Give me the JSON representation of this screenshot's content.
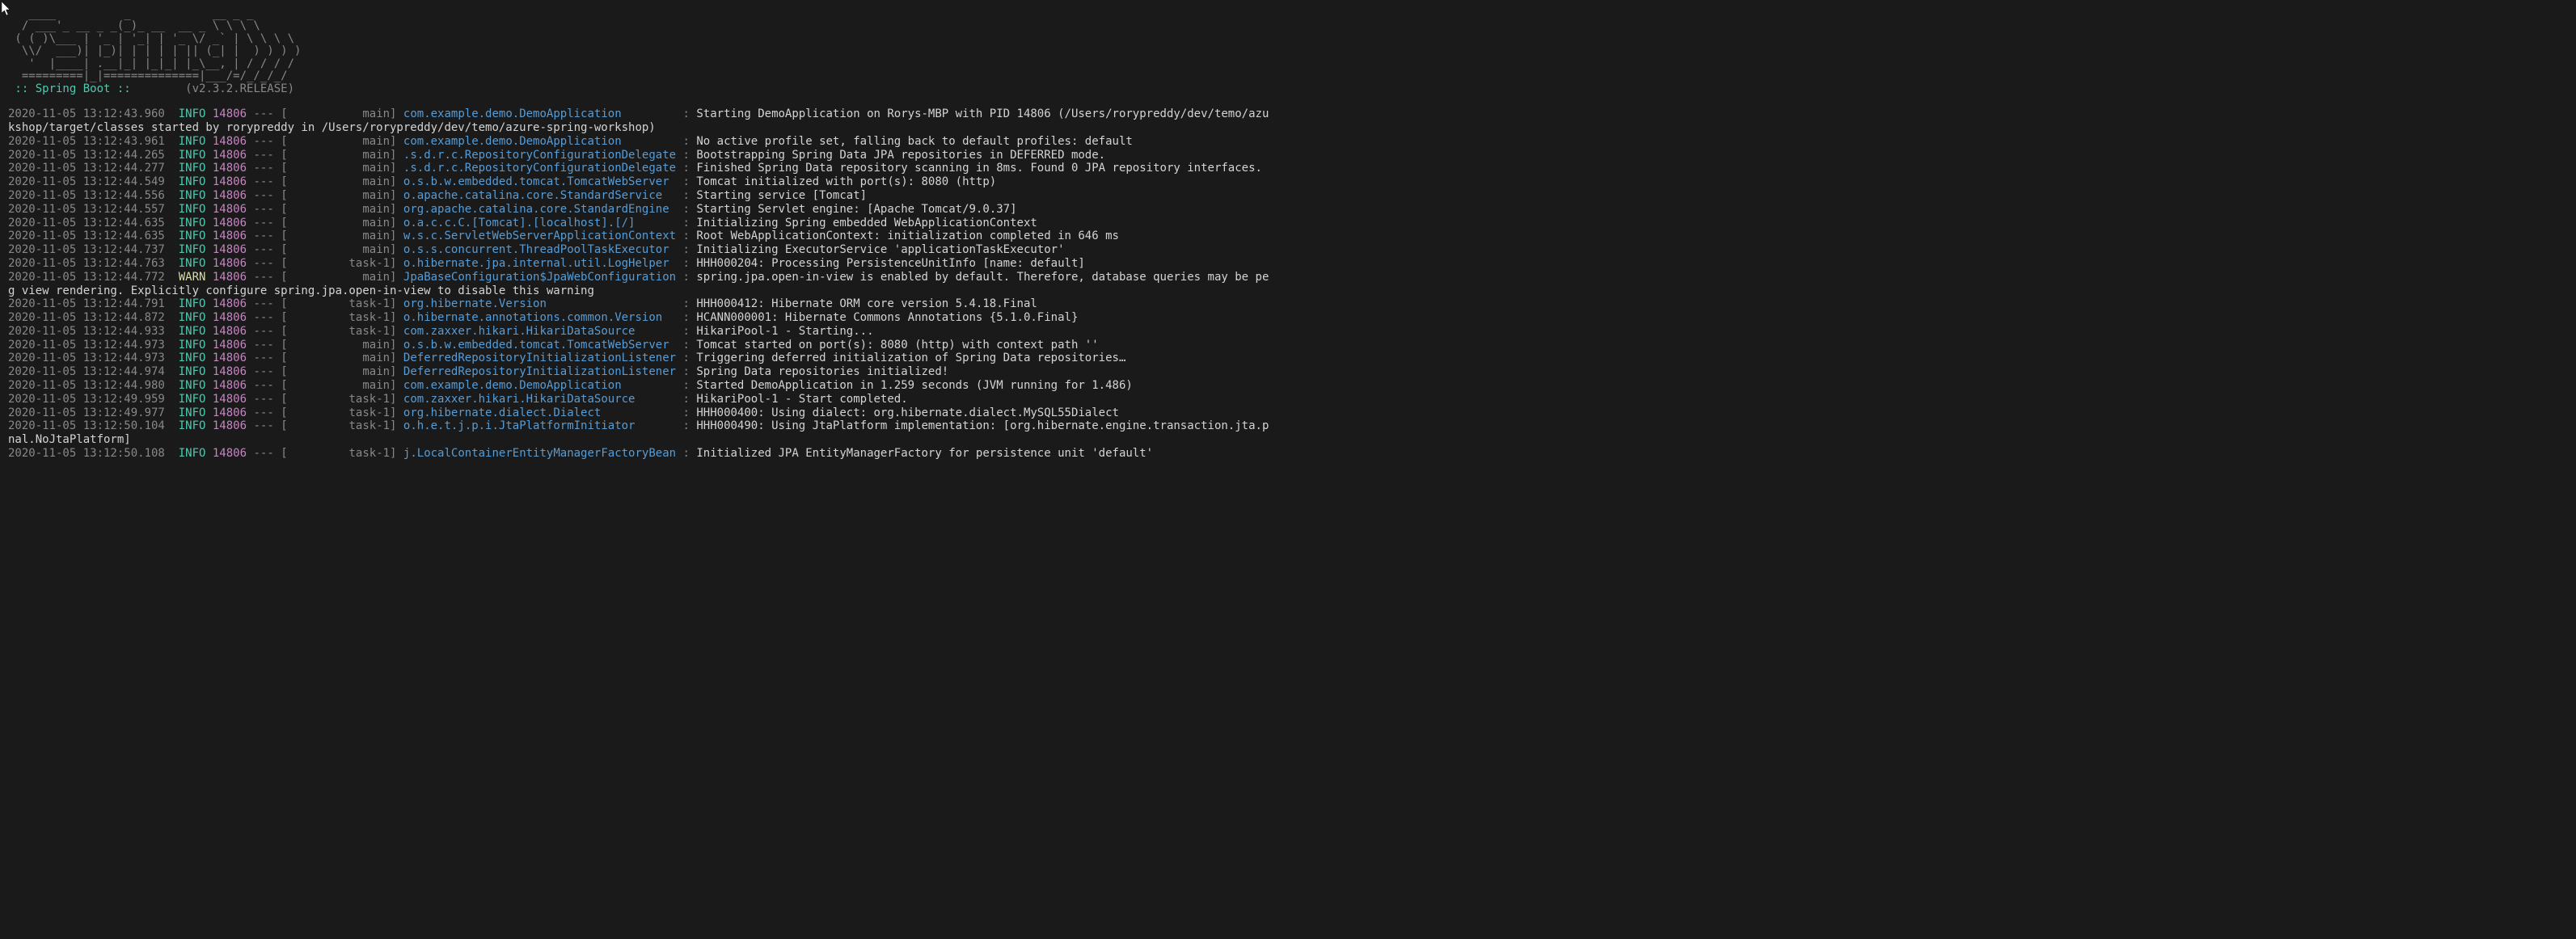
{
  "ascii_art": "   ____          _            __ _ _\n  / ___'_ __ _ _(_)_ __  __ _ \\ \\ \\ \\\n ( ( )\\___ | '_ | '_| | '_ \\/ _` | \\ \\ \\ \\\n  \\\\/  ___)| |_)| | | | | || (_| |  ) ) ) )\n   '  |____| .__|_| |_|_| |_\\__, | / / / /\n  =========|_|==============|___/=/_/_/_/",
  "banner": {
    "label": " :: Spring Boot ::",
    "spacer": "        ",
    "version": "(v2.3.2.RELEASE)"
  },
  "logs": [
    {
      "ts": "2020-11-05 13:12:43.960",
      "level": "INFO",
      "pid": "14806",
      "thread": "main",
      "logger": "com.example.demo.DemoApplication",
      "msg": "Starting DemoApplication on Rorys-MBP with PID 14806 (/Users/rorypreddy/dev/temo/azu"
    },
    {
      "wrap": "kshop/target/classes started by rorypreddy in /Users/rorypreddy/dev/temo/azure-spring-workshop)"
    },
    {
      "ts": "2020-11-05 13:12:43.961",
      "level": "INFO",
      "pid": "14806",
      "thread": "main",
      "logger": "com.example.demo.DemoApplication",
      "msg": "No active profile set, falling back to default profiles: default"
    },
    {
      "ts": "2020-11-05 13:12:44.265",
      "level": "INFO",
      "pid": "14806",
      "thread": "main",
      "logger": ".s.d.r.c.RepositoryConfigurationDelegate",
      "msg": "Bootstrapping Spring Data JPA repositories in DEFERRED mode."
    },
    {
      "ts": "2020-11-05 13:12:44.277",
      "level": "INFO",
      "pid": "14806",
      "thread": "main",
      "logger": ".s.d.r.c.RepositoryConfigurationDelegate",
      "msg": "Finished Spring Data repository scanning in 8ms. Found 0 JPA repository interfaces."
    },
    {
      "ts": "2020-11-05 13:12:44.549",
      "level": "INFO",
      "pid": "14806",
      "thread": "main",
      "logger": "o.s.b.w.embedded.tomcat.TomcatWebServer",
      "msg": "Tomcat initialized with port(s): 8080 (http)"
    },
    {
      "ts": "2020-11-05 13:12:44.556",
      "level": "INFO",
      "pid": "14806",
      "thread": "main",
      "logger": "o.apache.catalina.core.StandardService",
      "msg": "Starting service [Tomcat]"
    },
    {
      "ts": "2020-11-05 13:12:44.557",
      "level": "INFO",
      "pid": "14806",
      "thread": "main",
      "logger": "org.apache.catalina.core.StandardEngine",
      "msg": "Starting Servlet engine: [Apache Tomcat/9.0.37]"
    },
    {
      "ts": "2020-11-05 13:12:44.635",
      "level": "INFO",
      "pid": "14806",
      "thread": "main",
      "logger": "o.a.c.c.C.[Tomcat].[localhost].[/]",
      "msg": "Initializing Spring embedded WebApplicationContext"
    },
    {
      "ts": "2020-11-05 13:12:44.635",
      "level": "INFO",
      "pid": "14806",
      "thread": "main",
      "logger": "w.s.c.ServletWebServerApplicationContext",
      "msg": "Root WebApplicationContext: initialization completed in 646 ms"
    },
    {
      "ts": "2020-11-05 13:12:44.737",
      "level": "INFO",
      "pid": "14806",
      "thread": "main",
      "logger": "o.s.s.concurrent.ThreadPoolTaskExecutor",
      "msg": "Initializing ExecutorService 'applicationTaskExecutor'"
    },
    {
      "ts": "2020-11-05 13:12:44.763",
      "level": "INFO",
      "pid": "14806",
      "thread": "task-1",
      "logger": "o.hibernate.jpa.internal.util.LogHelper",
      "msg": "HHH000204: Processing PersistenceUnitInfo [name: default]"
    },
    {
      "ts": "2020-11-05 13:12:44.772",
      "level": "WARN",
      "pid": "14806",
      "thread": "main",
      "logger": "JpaBaseConfiguration$JpaWebConfiguration",
      "msg": "spring.jpa.open-in-view is enabled by default. Therefore, database queries may be pe"
    },
    {
      "wrap": "g view rendering. Explicitly configure spring.jpa.open-in-view to disable this warning"
    },
    {
      "ts": "2020-11-05 13:12:44.791",
      "level": "INFO",
      "pid": "14806",
      "thread": "task-1",
      "logger": "org.hibernate.Version",
      "msg": "HHH000412: Hibernate ORM core version 5.4.18.Final"
    },
    {
      "ts": "2020-11-05 13:12:44.872",
      "level": "INFO",
      "pid": "14806",
      "thread": "task-1",
      "logger": "o.hibernate.annotations.common.Version",
      "msg": "HCANN000001: Hibernate Commons Annotations {5.1.0.Final}"
    },
    {
      "ts": "2020-11-05 13:12:44.933",
      "level": "INFO",
      "pid": "14806",
      "thread": "task-1",
      "logger": "com.zaxxer.hikari.HikariDataSource",
      "msg": "HikariPool-1 - Starting..."
    },
    {
      "ts": "2020-11-05 13:12:44.973",
      "level": "INFO",
      "pid": "14806",
      "thread": "main",
      "logger": "o.s.b.w.embedded.tomcat.TomcatWebServer",
      "msg": "Tomcat started on port(s): 8080 (http) with context path ''"
    },
    {
      "ts": "2020-11-05 13:12:44.973",
      "level": "INFO",
      "pid": "14806",
      "thread": "main",
      "logger": "DeferredRepositoryInitializationListener",
      "msg": "Triggering deferred initialization of Spring Data repositories…"
    },
    {
      "ts": "2020-11-05 13:12:44.974",
      "level": "INFO",
      "pid": "14806",
      "thread": "main",
      "logger": "DeferredRepositoryInitializationListener",
      "msg": "Spring Data repositories initialized!"
    },
    {
      "ts": "2020-11-05 13:12:44.980",
      "level": "INFO",
      "pid": "14806",
      "thread": "main",
      "logger": "com.example.demo.DemoApplication",
      "msg": "Started DemoApplication in 1.259 seconds (JVM running for 1.486)"
    },
    {
      "ts": "2020-11-05 13:12:49.959",
      "level": "INFO",
      "pid": "14806",
      "thread": "task-1",
      "logger": "com.zaxxer.hikari.HikariDataSource",
      "msg": "HikariPool-1 - Start completed."
    },
    {
      "ts": "2020-11-05 13:12:49.977",
      "level": "INFO",
      "pid": "14806",
      "thread": "task-1",
      "logger": "org.hibernate.dialect.Dialect",
      "msg": "HHH000400: Using dialect: org.hibernate.dialect.MySQL55Dialect"
    },
    {
      "ts": "2020-11-05 13:12:50.104",
      "level": "INFO",
      "pid": "14806",
      "thread": "task-1",
      "logger": "o.h.e.t.j.p.i.JtaPlatformInitiator",
      "msg": "HHH000490: Using JtaPlatform implementation: [org.hibernate.engine.transaction.jta.p"
    },
    {
      "wrap": "nal.NoJtaPlatform]"
    },
    {
      "ts": "2020-11-05 13:12:50.108",
      "level": "INFO",
      "pid": "14806",
      "thread": "task-1",
      "logger": "j.LocalContainerEntityManagerFactoryBean",
      "msg": "Initialized JPA EntityManagerFactory for persistence unit 'default'"
    }
  ]
}
